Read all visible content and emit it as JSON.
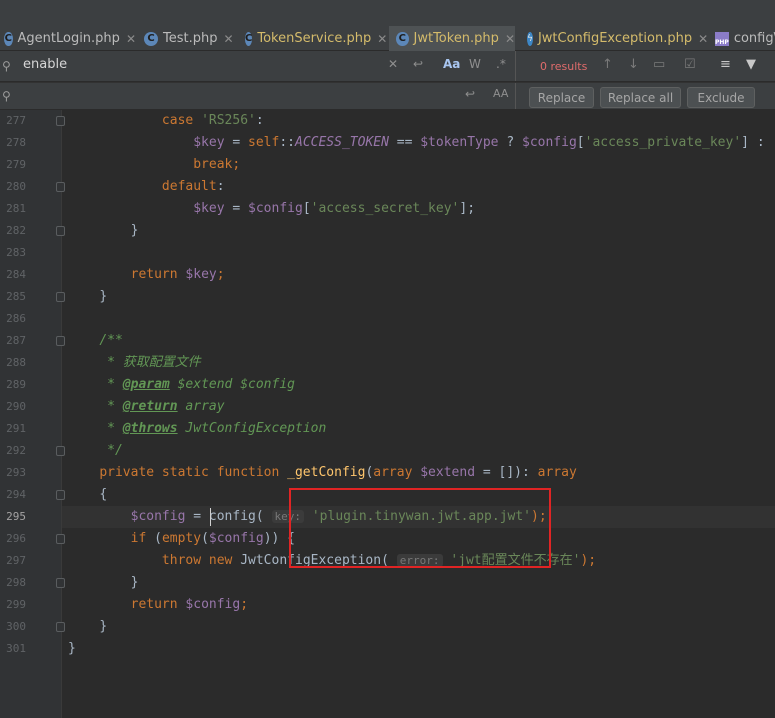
{
  "tabs": [
    {
      "label": "AgentLogin.php",
      "icon": "class-icon"
    },
    {
      "label": "Test.php",
      "icon": "class-icon"
    },
    {
      "label": "TokenService.php",
      "icon": "class-icon"
    },
    {
      "label": "JwtToken.php",
      "icon": "class-icon"
    },
    {
      "label": "JwtConfigException.php",
      "icon": "exception-class-icon"
    },
    {
      "label": "config\\",
      "icon": "php-file-icon"
    }
  ],
  "search": {
    "find_value": "enable",
    "results": "0 results",
    "toggle_case": "Aa",
    "toggle_words": "W",
    "toggle_regex": ".*",
    "preserve_case": "AA"
  },
  "replace_buttons": {
    "replace": "Replace",
    "replace_all": "Replace all",
    "exclude": "Exclude"
  },
  "editor": {
    "line_numbers": [
      "277",
      "278",
      "279",
      "280",
      "281",
      "282",
      "283",
      "284",
      "285",
      "286",
      "287",
      "288",
      "289",
      "290",
      "291",
      "292",
      "293",
      "294",
      "295",
      "296",
      "297",
      "298",
      "299",
      "300",
      "301"
    ],
    "current_line": "295",
    "lines": [
      {
        "indent": "            ",
        "segs": [
          {
            "t": "case ",
            "c": "k"
          },
          {
            "t": "'RS256'",
            "c": "s"
          },
          {
            "t": ":",
            "c": ""
          }
        ]
      },
      {
        "indent": "                ",
        "segs": [
          {
            "t": "$key",
            "c": "v"
          },
          {
            "t": " = ",
            "c": ""
          },
          {
            "t": "self",
            "c": "k"
          },
          {
            "t": "::",
            "c": ""
          },
          {
            "t": "ACCESS_TOKEN",
            "c": "cst"
          },
          {
            "t": " == ",
            "c": ""
          },
          {
            "t": "$tokenType",
            "c": "v"
          },
          {
            "t": " ? ",
            "c": ""
          },
          {
            "t": "$config",
            "c": "v"
          },
          {
            "t": "[",
            "c": ""
          },
          {
            "t": "'access_private_key'",
            "c": "s"
          },
          {
            "t": "] :",
            "c": ""
          }
        ]
      },
      {
        "indent": "                ",
        "segs": [
          {
            "t": "break",
            "c": "k"
          },
          {
            "t": ";",
            "c": "k"
          }
        ]
      },
      {
        "indent": "            ",
        "segs": [
          {
            "t": "default",
            "c": "k"
          },
          {
            "t": ":",
            "c": ""
          }
        ]
      },
      {
        "indent": "                ",
        "segs": [
          {
            "t": "$key",
            "c": "v"
          },
          {
            "t": " = ",
            "c": ""
          },
          {
            "t": "$config",
            "c": "v"
          },
          {
            "t": "[",
            "c": ""
          },
          {
            "t": "'access_secret_key'",
            "c": "s"
          },
          {
            "t": "];",
            "c": ""
          }
        ]
      },
      {
        "indent": "        ",
        "segs": [
          {
            "t": "}",
            "c": ""
          }
        ]
      },
      {
        "indent": "",
        "segs": []
      },
      {
        "indent": "        ",
        "segs": [
          {
            "t": "return ",
            "c": "k"
          },
          {
            "t": "$key",
            "c": "v"
          },
          {
            "t": ";",
            "c": "k"
          }
        ]
      },
      {
        "indent": "    ",
        "segs": [
          {
            "t": "}",
            "c": ""
          }
        ]
      },
      {
        "indent": "",
        "segs": []
      },
      {
        "indent": "    ",
        "segs": [
          {
            "t": "/**",
            "c": "c"
          }
        ]
      },
      {
        "indent": "     ",
        "segs": [
          {
            "t": "* 获取配置文件",
            "c": "c"
          }
        ]
      },
      {
        "indent": "     ",
        "segs": [
          {
            "t": "* ",
            "c": "c"
          },
          {
            "t": "@param",
            "c": "tag"
          },
          {
            "t": " $extend $config",
            "c": "c"
          }
        ]
      },
      {
        "indent": "     ",
        "segs": [
          {
            "t": "* ",
            "c": "c"
          },
          {
            "t": "@return",
            "c": "tag"
          },
          {
            "t": " array",
            "c": "cst2"
          }
        ]
      },
      {
        "indent": "     ",
        "segs": [
          {
            "t": "* ",
            "c": "c"
          },
          {
            "t": "@throws",
            "c": "tag"
          },
          {
            "t": " JwtConfigException",
            "c": "cst2"
          }
        ]
      },
      {
        "indent": "     ",
        "segs": [
          {
            "t": "*/",
            "c": "c"
          }
        ]
      },
      {
        "indent": "    ",
        "segs": [
          {
            "t": "private static function ",
            "c": "k"
          },
          {
            "t": "_getConfig",
            "c": "f"
          },
          {
            "t": "(",
            "c": ""
          },
          {
            "t": "array ",
            "c": "k"
          },
          {
            "t": "$extend",
            "c": "v"
          },
          {
            "t": " = []): ",
            "c": ""
          },
          {
            "t": "array",
            "c": "k"
          }
        ]
      },
      {
        "indent": "    ",
        "segs": [
          {
            "t": "{",
            "c": ""
          }
        ]
      },
      {
        "indent": "        ",
        "segs": [
          {
            "t": "$config",
            "c": "v"
          },
          {
            "t": " = ",
            "c": ""
          },
          {
            "t": "config",
            "c": ""
          },
          {
            "t": "( ",
            "c": ""
          },
          {
            "t": "key:",
            "c": "hint"
          },
          {
            "t": " 'plugin.tinywan.jwt.app.jwt'",
            "c": "s"
          },
          {
            "t": ");",
            "c": "k"
          }
        ]
      },
      {
        "indent": "        ",
        "segs": [
          {
            "t": "if ",
            "c": "k"
          },
          {
            "t": "(",
            "c": ""
          },
          {
            "t": "empty",
            "c": "k"
          },
          {
            "t": "(",
            "c": ""
          },
          {
            "t": "$config",
            "c": "v"
          },
          {
            "t": ")) {",
            "c": ""
          }
        ]
      },
      {
        "indent": "            ",
        "segs": [
          {
            "t": "throw new ",
            "c": "k"
          },
          {
            "t": "JwtConfigException",
            "c": ""
          },
          {
            "t": "( ",
            "c": ""
          },
          {
            "t": "error:",
            "c": "hint"
          },
          {
            "t": " 'jwt配置文件不存在'",
            "c": "s"
          },
          {
            "t": ");",
            "c": "k"
          }
        ]
      },
      {
        "indent": "        ",
        "segs": [
          {
            "t": "}",
            "c": ""
          }
        ]
      },
      {
        "indent": "        ",
        "segs": [
          {
            "t": "return ",
            "c": "k"
          },
          {
            "t": "$config",
            "c": "v"
          },
          {
            "t": ";",
            "c": "k"
          }
        ]
      },
      {
        "indent": "    ",
        "segs": [
          {
            "t": "}",
            "c": ""
          }
        ]
      },
      {
        "indent": "",
        "segs": [
          {
            "t": "}",
            "c": ""
          }
        ]
      }
    ]
  },
  "colors": {
    "highlight_box": "#e02424",
    "keyword": "#cc7832",
    "string": "#6a8759",
    "variable": "#9876aa"
  }
}
